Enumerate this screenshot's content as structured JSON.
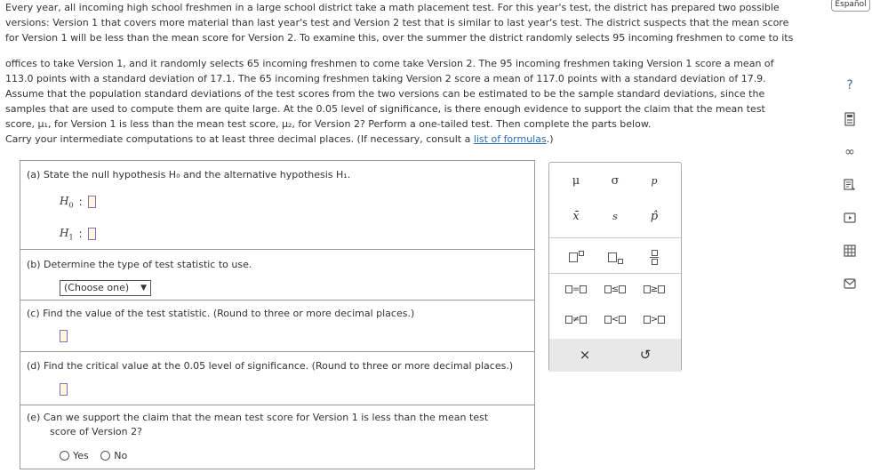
{
  "problem": {
    "line1": "Every year, all incoming high school freshmen in a large school district take a math placement test. For this year's test, the district has prepared two possible",
    "line2": "versions: Version 1 that covers more material than last year's test and Version 2 test that is similar to last year's test. The district suspects that the mean score",
    "line3": "for Version 1 will be less than the mean score for Version 2. To examine this, over the summer the district randomly selects 95 incoming freshmen to come to its",
    "line4": "offices to take Version 1, and it randomly selects 65 incoming freshmen to come take Version 2. The 95 incoming freshmen taking Version 1 score a mean of",
    "line5": "113.0 points with a standard deviation of 17.1. The 65 incoming freshmen taking Version 2 score a mean of 117.0 points with a standard deviation of 17.9.",
    "line6": "Assume that the population standard deviations of the test scores from the two versions can be estimated to be the sample standard deviations, since the",
    "line7": "samples that are used to compute them are quite large. At the 0.05 level of significance, is there enough evidence to support the claim that the mean test",
    "line8": "score, μ₁, for Version 1 is less than the mean test score, μ₂, for Version 2? Perform a one-tailed test. Then complete the parts below."
  },
  "instructions": {
    "text": "Carry your intermediate computations to at least three decimal places. (If necessary, consult a ",
    "link": "list of formulas",
    "tail": ".)"
  },
  "parts": {
    "a": {
      "label": "(a)  State the null hypothesis H₀ and the alternative hypothesis H₁.",
      "h0": "H",
      "h0_sub": "0",
      "h1": "H",
      "h1_sub": "1",
      "colon": ":"
    },
    "b": {
      "label": "(b)  Determine the type of test statistic to use.",
      "select_value": "(Choose one)",
      "select_arrow": "▼"
    },
    "c": {
      "label": "(c)  Find the value of the test statistic. (Round to three or more decimal places.)"
    },
    "d": {
      "label": "(d)  Find the critical value at the 0.05 level of significance. (Round to three or more decimal places.)"
    },
    "e": {
      "label_line1": "(e)  Can we support the claim that the mean test score for Version 1 is less than the mean test",
      "label_line2": "score of Version 2?",
      "yes": "Yes",
      "no": "No"
    }
  },
  "keypad": {
    "row1": [
      "μ",
      "σ",
      "p"
    ],
    "row2": [
      "x̄",
      "s",
      "p̂"
    ],
    "row4": [
      "=",
      "≤",
      "≥"
    ],
    "row5": [
      "≠",
      "<",
      ">"
    ],
    "clear": "×",
    "undo": "↺"
  },
  "sidebar": {
    "language": "Español",
    "help_icon": "?",
    "icons": [
      "help-icon",
      "calculator-icon",
      "infinity-icon",
      "data-icon",
      "video-icon",
      "table-icon",
      "mail-icon"
    ]
  }
}
